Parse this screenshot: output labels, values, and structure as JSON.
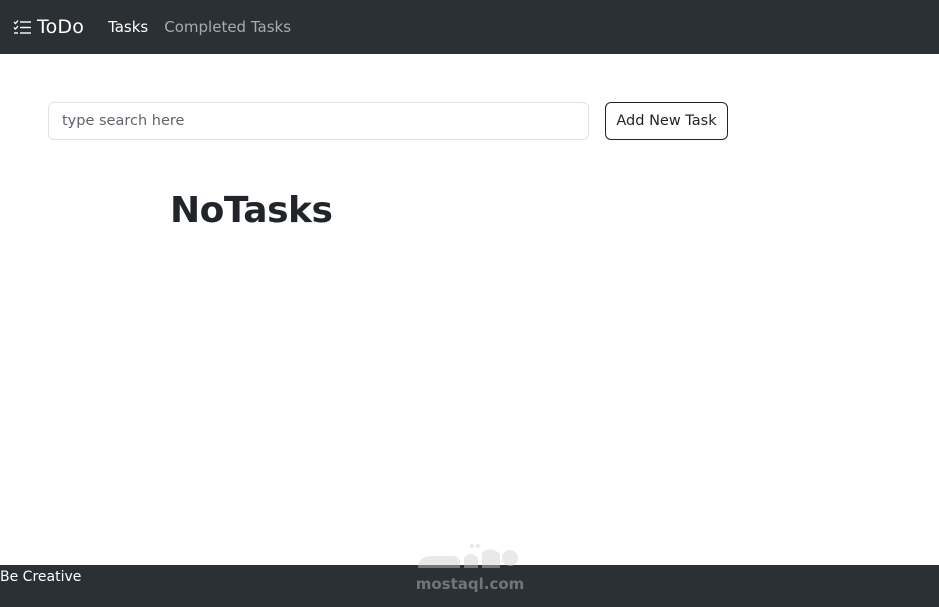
{
  "navbar": {
    "brand": "ToDo",
    "brand_icon": "checklist-icon",
    "links": [
      {
        "label": "Tasks",
        "active": true
      },
      {
        "label": "Completed Tasks",
        "active": false
      }
    ]
  },
  "search": {
    "placeholder": "type search here",
    "value": ""
  },
  "actions": {
    "add_label": "Add New Task"
  },
  "main": {
    "empty_message": "NoTasks"
  },
  "footer": {
    "text": "Be Creative"
  },
  "watermark": {
    "text": "mostaql.com"
  },
  "colors": {
    "navbar_bg": "#2b3035",
    "text_dark": "#212529",
    "nav_muted": "#a8abae"
  }
}
